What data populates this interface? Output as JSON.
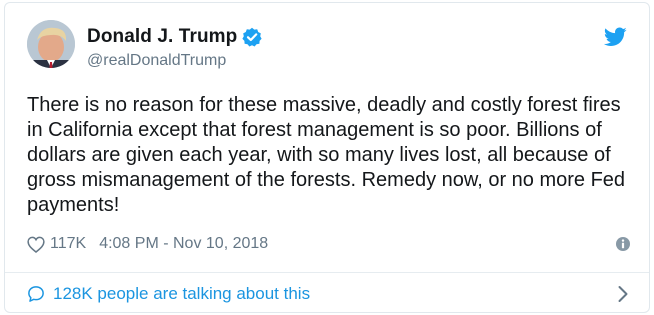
{
  "author": {
    "display_name": "Donald J. Trump",
    "handle": "@realDonaldTrump",
    "verified": true,
    "avatar_icon": "profile-photo"
  },
  "brand": {
    "icon": "twitter-bird-icon",
    "accent_color": "#1da1f2"
  },
  "tweet": {
    "text": "There is no reason for these massive, deadly and costly forest fires\nin California except that forest management is so poor. Billions of\ndollars are given each year, with so many lives lost, all because of\ngross mismanagement of the forests. Remedy now, or no more Fed\npayments!",
    "like_count": "117K",
    "timestamp": "4:08 PM - Nov 10, 2018"
  },
  "footer": {
    "talking_label": "128K people are talking about this",
    "link_color": "#1b95e0"
  }
}
